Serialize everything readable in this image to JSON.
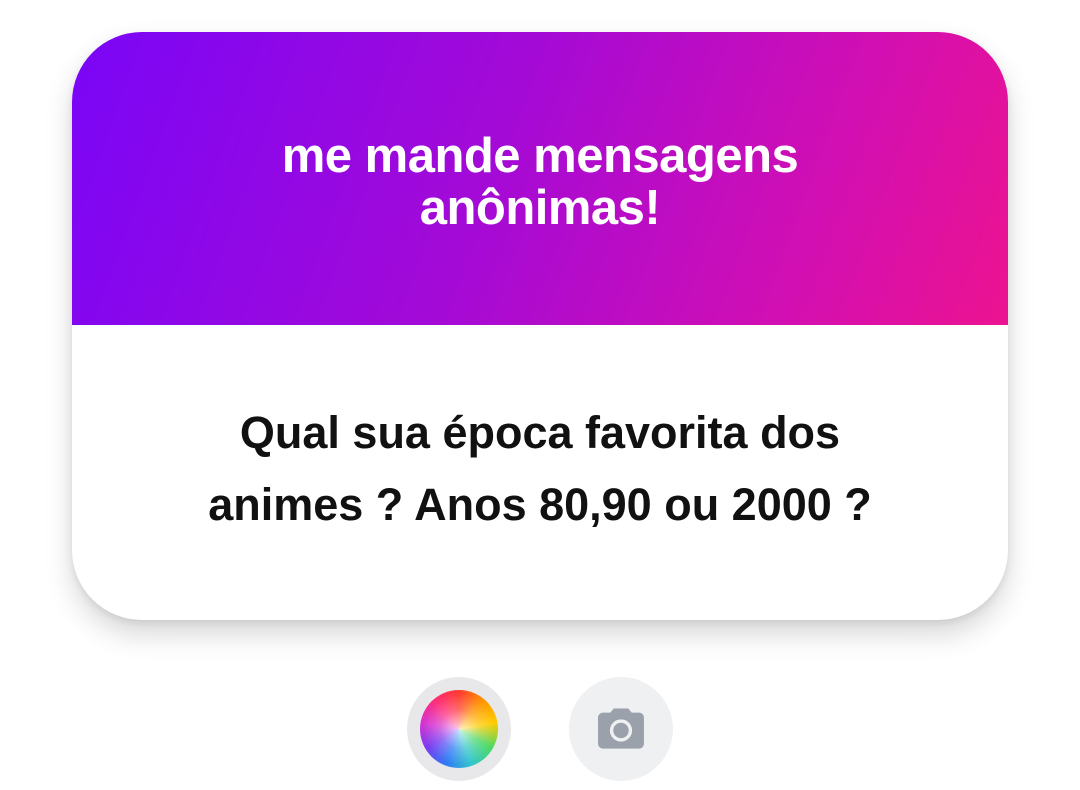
{
  "card": {
    "title": "me mande mensagens\nanônimas!",
    "question": "Qual sua época favorita dos\nanimes ? Anos 80,90 ou 2000 ?",
    "gradient_start": "#7a05f7",
    "gradient_end": "#ec1390"
  },
  "controls": {
    "color_button_icon": "color-wheel-icon",
    "camera_button_icon": "camera-icon",
    "camera_icon_color": "#9aa1ab"
  }
}
